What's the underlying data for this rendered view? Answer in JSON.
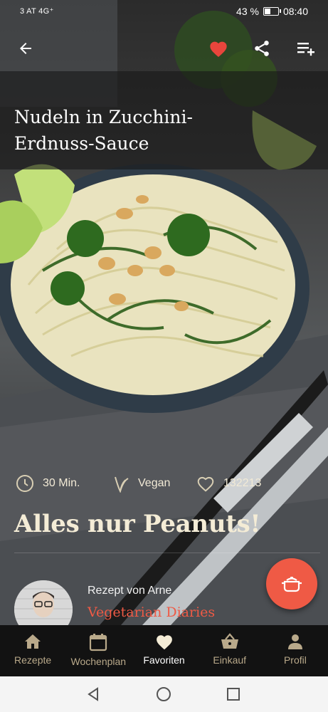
{
  "status_bar": {
    "carrier": "3 AT 4G⁺",
    "battery": "43 %",
    "battery_level": 0.43,
    "time": "08:40"
  },
  "header": {
    "back_icon": "arrow-left-icon",
    "favorite_icon": "heart-icon",
    "share_icon": "share-icon",
    "add_to_list_icon": "playlist-add-icon",
    "favorite_color": "#e8453c"
  },
  "recipe": {
    "title": "Nudeln in Zucchini-Erdnuss-Sauce",
    "time": "30 Min.",
    "diet": "Vegan",
    "likes": "132213",
    "headline": "Alles nur Peanuts!",
    "author_label": "Rezept von Arne",
    "author_blog": "Vegetarian Diaries"
  },
  "fab": {
    "icon": "cooking-pot-icon",
    "color": "#ef5a45"
  },
  "tabs": [
    {
      "label": "Rezepte",
      "icon": "home-icon"
    },
    {
      "label": "Wochenplan",
      "icon": "calendar-icon"
    },
    {
      "label": "Favoriten",
      "icon": "heart-icon",
      "active": true
    },
    {
      "label": "Einkauf",
      "icon": "basket-icon"
    },
    {
      "label": "Profil",
      "icon": "person-icon"
    }
  ],
  "nav": {
    "back": "back-triangle-icon",
    "home": "home-circle-icon",
    "recents": "recents-square-icon"
  },
  "colors": {
    "accent": "#ef5a45",
    "tab_inactive": "#b9a98a",
    "tab_bar": "#121212"
  }
}
